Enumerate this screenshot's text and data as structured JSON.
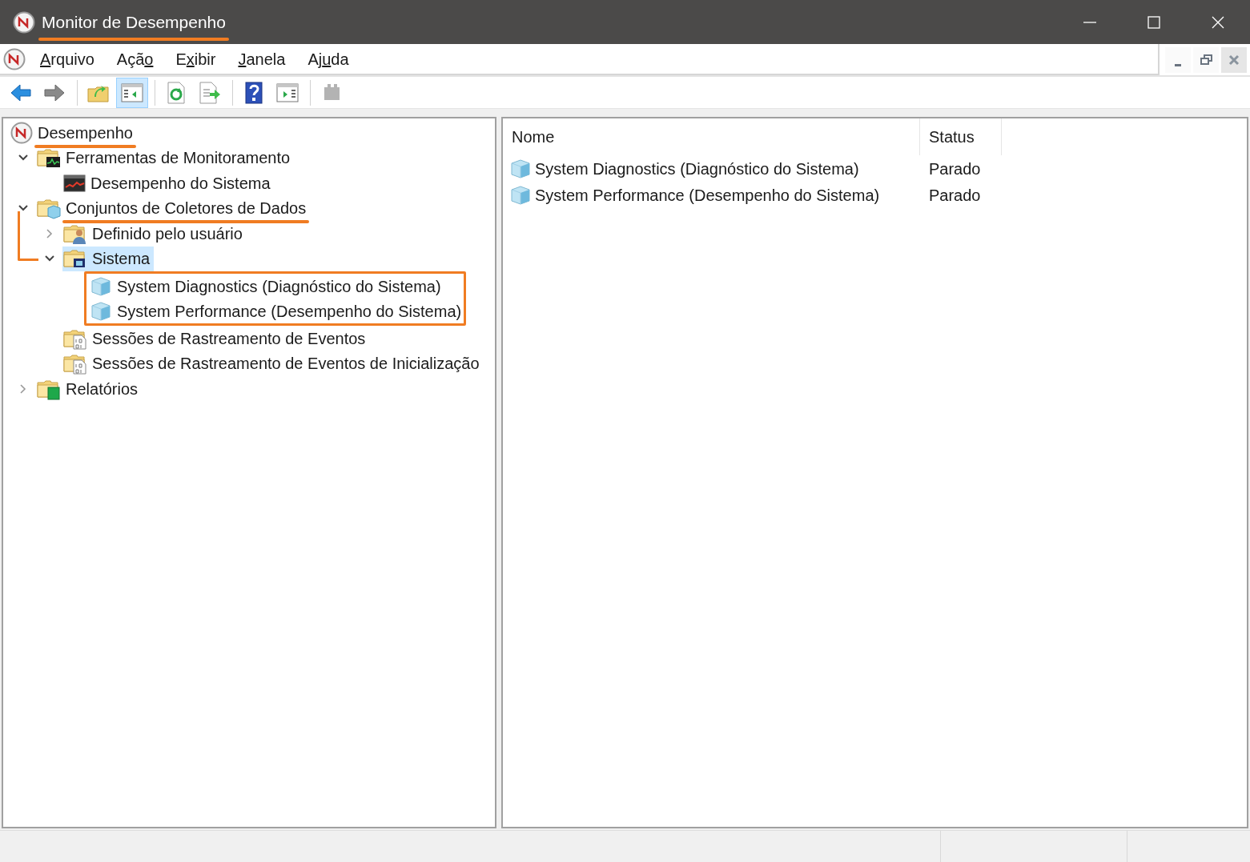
{
  "window": {
    "title": "Monitor de Desempenho",
    "title_underlined": true
  },
  "menu": [
    {
      "key": "A",
      "post": "rquivo"
    },
    {
      "pre": "Açã",
      "key": "o"
    },
    {
      "pre": "E",
      "key": "x",
      "post": "ibir"
    },
    {
      "key": "J",
      "post": "anela"
    },
    {
      "pre": "Aj",
      "key": "u",
      "post": "da"
    }
  ],
  "toolbar": [
    {
      "kind": "back",
      "pressed": false,
      "disabled": false
    },
    {
      "kind": "forward",
      "pressed": false,
      "disabled": false
    },
    {
      "kind": "separator"
    },
    {
      "kind": "up",
      "pressed": false,
      "disabled": false
    },
    {
      "kind": "tree-pane",
      "pressed": true,
      "disabled": false
    },
    {
      "kind": "separator"
    },
    {
      "kind": "refresh",
      "pressed": false,
      "disabled": false
    },
    {
      "kind": "export",
      "pressed": false,
      "disabled": false
    },
    {
      "kind": "separator"
    },
    {
      "kind": "help",
      "pressed": false,
      "disabled": false
    },
    {
      "kind": "action-pane",
      "pressed": false,
      "disabled": false
    },
    {
      "kind": "separator"
    },
    {
      "kind": "plug",
      "pressed": false,
      "disabled": true
    }
  ],
  "tree": {
    "label": "Desempenho",
    "kind": "gauge",
    "selected": false,
    "underlined": true,
    "children": [
      {
        "label": "Ferramentas de Monitoramento",
        "kind": "folder-monitor",
        "expanded": true,
        "selected": false,
        "underlined": false,
        "children": [
          {
            "label": "Desempenho do Sistema",
            "kind": "chart",
            "selected": false,
            "underlined": false
          }
        ]
      },
      {
        "label": "Conjuntos de Coletores de Dados",
        "kind": "folder-collector",
        "expanded": true,
        "selected": false,
        "underlined": true,
        "children": [
          {
            "label": "Definido pelo usuário",
            "kind": "folder-user",
            "expanded": false,
            "selected": false,
            "underlined": false
          },
          {
            "label": "Sistema",
            "kind": "folder-system",
            "expanded": true,
            "selected": true,
            "underlined": false,
            "bracket": true,
            "children_boxed": true,
            "children": [
              {
                "label": "System Diagnostics (Diagnóstico do Sistema)",
                "kind": "cube",
                "selected": false,
                "underlined": false
              },
              {
                "label": "System Performance (Desempenho do Sistema)",
                "kind": "cube",
                "selected": false,
                "underlined": false
              }
            ]
          },
          {
            "label": "Sessões de Rastreamento de Eventos",
            "kind": "folder-trace",
            "selected": false,
            "underlined": false
          },
          {
            "label": "Sessões de Rastreamento de Eventos de Inicialização",
            "kind": "folder-trace",
            "selected": false,
            "underlined": false
          }
        ]
      },
      {
        "label": "Relatórios",
        "kind": "folder-report",
        "expanded": false,
        "selected": false,
        "underlined": false
      }
    ]
  },
  "list": {
    "columns": [
      "Nome",
      "Status"
    ],
    "rows": [
      {
        "name": "System Diagnostics (Diagnóstico do Sistema)",
        "status": "Parado"
      },
      {
        "name": "System Performance (Desempenho do Sistema)",
        "status": "Parado"
      }
    ]
  }
}
